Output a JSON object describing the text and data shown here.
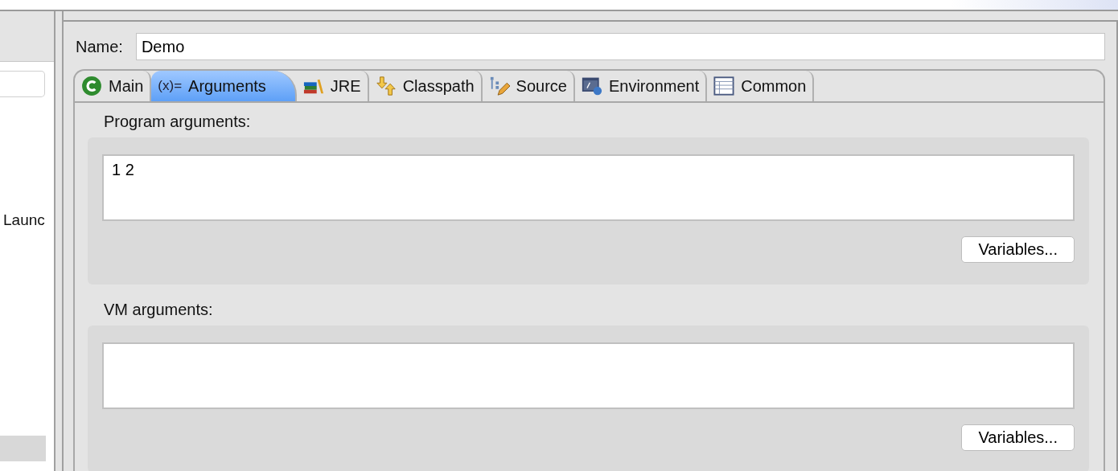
{
  "sidebar": {
    "items": [
      {
        "label": "Launc"
      }
    ]
  },
  "name_field": {
    "label": "Name:",
    "value": "Demo"
  },
  "tabs": [
    {
      "kind": "main",
      "label": "Main",
      "selected": false
    },
    {
      "kind": "arguments",
      "glyph": "(x)=",
      "label": "Arguments",
      "selected": true
    },
    {
      "kind": "jre",
      "label": "JRE",
      "selected": false
    },
    {
      "kind": "classpath",
      "label": "Classpath",
      "selected": false
    },
    {
      "kind": "source",
      "label": "Source",
      "selected": false
    },
    {
      "kind": "environment",
      "label": "Environment",
      "selected": false
    },
    {
      "kind": "common",
      "label": "Common",
      "selected": false
    }
  ],
  "sections": [
    {
      "label": "Program arguments:",
      "value": "1 2",
      "button": "Variables..."
    },
    {
      "label": "VM arguments:",
      "button": "Variables..."
    }
  ]
}
